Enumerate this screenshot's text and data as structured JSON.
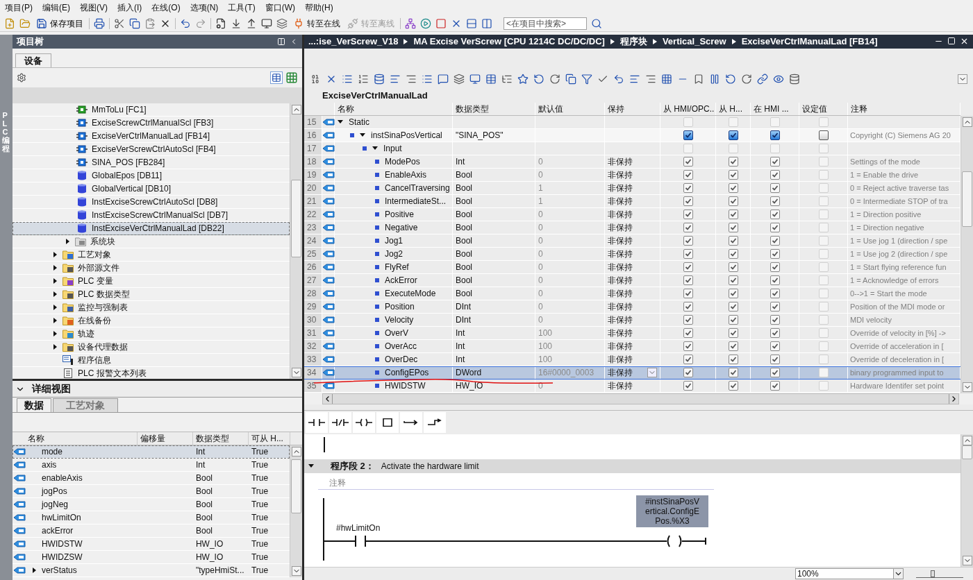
{
  "menu": [
    "项目(P)",
    "编辑(E)",
    "视图(V)",
    "插入(I)",
    "在线(O)",
    "选项(N)",
    "工具(T)",
    "窗口(W)",
    "帮助(H)"
  ],
  "toolbar": {
    "save_label": "保存项目",
    "go_online": {
      "label": "转至在线",
      "disabled": false
    },
    "go_offline": {
      "label": "转至离线",
      "disabled": true
    },
    "search_placeholder": "<在项目中搜索>"
  },
  "side_strip": "PLC 编程",
  "project_tree": {
    "title": "项目树",
    "tabs": [
      {
        "label": "设备",
        "selected": true
      }
    ],
    "blocks": [
      {
        "kind": "fc",
        "label": "MmToLu [FC1]",
        "selected": false
      },
      {
        "kind": "fb",
        "label": "ExciseScrewCtrlManualScl [FB3]",
        "selected": false
      },
      {
        "kind": "fb",
        "label": "ExciseVerCtrlManualLad [FB14]",
        "selected": false
      },
      {
        "kind": "fb",
        "label": "ExciseVerScrewCtrlAutoScl [FB4]",
        "selected": false
      },
      {
        "kind": "fb",
        "label": "SINA_POS [FB284]",
        "selected": false
      },
      {
        "kind": "db",
        "label": "GlobalEpos [DB11]",
        "selected": false
      },
      {
        "kind": "db",
        "label": "GlobalVertical [DB10]",
        "selected": false
      },
      {
        "kind": "db",
        "label": "InstExciseScrewCtrlAutoScl [DB8]",
        "selected": false
      },
      {
        "kind": "db",
        "label": "InstExciseScrewCtrlManualScl [DB7]",
        "selected": false
      },
      {
        "kind": "db",
        "label": "InstExciseVerCtrlManualLad [DB22]",
        "selected": true
      }
    ],
    "system_blocks": {
      "label": "系统块",
      "expanded": false
    },
    "folders": [
      {
        "kind": "tech",
        "label": "工艺对象",
        "expanded": false
      },
      {
        "kind": "source",
        "label": "外部源文件",
        "expanded": false
      },
      {
        "kind": "tags",
        "label": "PLC 变量",
        "expanded": false
      },
      {
        "kind": "types",
        "label": "PLC 数据类型",
        "expanded": false
      },
      {
        "kind": "watch",
        "label": "监控与强制表",
        "expanded": false
      },
      {
        "kind": "backup",
        "label": "在线备份",
        "expanded": false
      },
      {
        "kind": "trace",
        "label": "轨迹",
        "expanded": false
      },
      {
        "kind": "proxy",
        "label": "设备代理数据",
        "expanded": false
      }
    ],
    "entries": [
      {
        "kind": "info",
        "label": "程序信息"
      },
      {
        "kind": "textlist",
        "label": "PLC 报警文本列表"
      }
    ]
  },
  "detail_view": {
    "title": "详细视图",
    "tabs": [
      {
        "label": "数据",
        "selected": true
      },
      {
        "label": "工艺对象",
        "selected": false
      }
    ],
    "columns": [
      "名称",
      "偏移量",
      "数据类型",
      "可从 H..."
    ],
    "rows": [
      {
        "name": "mode",
        "type": "Int",
        "access": "True",
        "selected": true
      },
      {
        "name": "axis",
        "type": "Int",
        "access": "True",
        "selected": false
      },
      {
        "name": "enableAxis",
        "type": "Bool",
        "access": "True",
        "selected": false
      },
      {
        "name": "jogPos",
        "type": "Bool",
        "access": "True",
        "selected": false
      },
      {
        "name": "jogNeg",
        "type": "Bool",
        "access": "True",
        "selected": false
      },
      {
        "name": "hwLimitOn",
        "type": "Bool",
        "access": "True",
        "selected": false
      },
      {
        "name": "ackError",
        "type": "Bool",
        "access": "True",
        "selected": false
      },
      {
        "name": "HWIDSTW",
        "type": "HW_IO",
        "access": "True",
        "selected": false
      },
      {
        "name": "HWIDZSW",
        "type": "HW_IO",
        "access": "True",
        "selected": false
      },
      {
        "name": "verStatus",
        "type": "\"typeHmiSt...",
        "access": "True",
        "selected": false,
        "expanded": false
      }
    ]
  },
  "editor": {
    "breadcrumb": [
      "...:ise_VerScrew_V18",
      "MA Excise VerScrew [CPU 1214C DC/DC/DC]",
      "程序块",
      "Vertical_Screw",
      "ExciseVerCtrlManualLad [FB14]"
    ],
    "block_title": "ExciseVerCtrlManualLad",
    "columns": [
      "名称",
      "数据类型",
      "默认值",
      "保持",
      "从 HMI/OPC..",
      "从 H...",
      "在 HMI ...",
      "设定值",
      "注释"
    ],
    "rows": [
      {
        "num": "15",
        "name": "Static",
        "expanded": true,
        "selected": false,
        "editable": false,
        "hmi_1": false,
        "hmi_2": false,
        "hmi_3": false,
        "setpoint": false,
        "children": [
          {
            "num": "16",
            "name": "instSinaPosVertical",
            "type": "\"SINA_POS\"",
            "expanded": true,
            "selected": false,
            "editable": true,
            "hmi_1": true,
            "hmi_2": true,
            "hmi_3": true,
            "setpoint": false,
            "comment": "Copyright (C) Siemens AG 20",
            "children": [
              {
                "num": "17",
                "name": "Input",
                "expanded": true,
                "selected": false,
                "editable": false,
                "hmi_1": false,
                "hmi_2": false,
                "hmi_3": false,
                "setpoint": false,
                "children": [
                  {
                    "num": "18",
                    "name": "ModePos",
                    "type": "Int",
                    "default": "0",
                    "retain": "非保持",
                    "selected": false,
                    "editable": false,
                    "hmi_1": true,
                    "hmi_2": true,
                    "hmi_3": true,
                    "setpoint": false,
                    "comment": "Settings of the mode"
                  },
                  {
                    "num": "19",
                    "name": "EnableAxis",
                    "type": "Bool",
                    "default": "0",
                    "retain": "非保持",
                    "selected": false,
                    "editable": false,
                    "hmi_1": true,
                    "hmi_2": true,
                    "hmi_3": true,
                    "setpoint": false,
                    "comment": "1 = Enable the drive"
                  },
                  {
                    "num": "20",
                    "name": "CancelTraversing",
                    "type": "Bool",
                    "default": "1",
                    "retain": "非保持",
                    "selected": false,
                    "editable": false,
                    "hmi_1": true,
                    "hmi_2": true,
                    "hmi_3": true,
                    "setpoint": false,
                    "comment": "0 = Reject active traverse tas"
                  },
                  {
                    "num": "21",
                    "name": "IntermediateSt...",
                    "type": "Bool",
                    "default": "1",
                    "retain": "非保持",
                    "selected": false,
                    "editable": false,
                    "hmi_1": true,
                    "hmi_2": true,
                    "hmi_3": true,
                    "setpoint": false,
                    "comment": "0 = Intermediate STOP of tra"
                  },
                  {
                    "num": "22",
                    "name": "Positive",
                    "type": "Bool",
                    "default": "0",
                    "retain": "非保持",
                    "selected": false,
                    "editable": false,
                    "hmi_1": true,
                    "hmi_2": true,
                    "hmi_3": true,
                    "setpoint": false,
                    "comment": "1 = Direction positive"
                  },
                  {
                    "num": "23",
                    "name": "Negative",
                    "type": "Bool",
                    "default": "0",
                    "retain": "非保持",
                    "selected": false,
                    "editable": false,
                    "hmi_1": true,
                    "hmi_2": true,
                    "hmi_3": true,
                    "setpoint": false,
                    "comment": "1 = Direction negative"
                  },
                  {
                    "num": "24",
                    "name": "Jog1",
                    "type": "Bool",
                    "default": "0",
                    "retain": "非保持",
                    "selected": false,
                    "editable": false,
                    "hmi_1": true,
                    "hmi_2": true,
                    "hmi_3": true,
                    "setpoint": false,
                    "comment": "1 = Use jog 1 (direction / spe"
                  },
                  {
                    "num": "25",
                    "name": "Jog2",
                    "type": "Bool",
                    "default": "0",
                    "retain": "非保持",
                    "selected": false,
                    "editable": false,
                    "hmi_1": true,
                    "hmi_2": true,
                    "hmi_3": true,
                    "setpoint": false,
                    "comment": "1 = Use jog 2 (direction / spe"
                  },
                  {
                    "num": "26",
                    "name": "FlyRef",
                    "type": "Bool",
                    "default": "0",
                    "retain": "非保持",
                    "selected": false,
                    "editable": false,
                    "hmi_1": true,
                    "hmi_2": true,
                    "hmi_3": true,
                    "setpoint": false,
                    "comment": "1 = Start flying reference fun"
                  },
                  {
                    "num": "27",
                    "name": "AckError",
                    "type": "Bool",
                    "default": "0",
                    "retain": "非保持",
                    "selected": false,
                    "editable": false,
                    "hmi_1": true,
                    "hmi_2": true,
                    "hmi_3": true,
                    "setpoint": false,
                    "comment": "1  = Acknowledge of errors"
                  },
                  {
                    "num": "28",
                    "name": "ExecuteMode",
                    "type": "Bool",
                    "default": "0",
                    "retain": "非保持",
                    "selected": false,
                    "editable": false,
                    "hmi_1": true,
                    "hmi_2": true,
                    "hmi_3": true,
                    "setpoint": false,
                    "comment": "0-->1 = Start the mode"
                  },
                  {
                    "num": "29",
                    "name": "Position",
                    "type": "DInt",
                    "default": "0",
                    "retain": "非保持",
                    "selected": false,
                    "editable": false,
                    "hmi_1": true,
                    "hmi_2": true,
                    "hmi_3": true,
                    "setpoint": false,
                    "comment": "Position of the MDI mode or"
                  },
                  {
                    "num": "30",
                    "name": "Velocity",
                    "type": "DInt",
                    "default": "0",
                    "retain": "非保持",
                    "selected": false,
                    "editable": false,
                    "hmi_1": true,
                    "hmi_2": true,
                    "hmi_3": true,
                    "setpoint": false,
                    "comment": "MDI velocity"
                  },
                  {
                    "num": "31",
                    "name": "OverV",
                    "type": "Int",
                    "default": "100",
                    "retain": "非保持",
                    "selected": false,
                    "editable": false,
                    "hmi_1": true,
                    "hmi_2": true,
                    "hmi_3": true,
                    "setpoint": false,
                    "comment": "Override of  velocity in [%] ->"
                  },
                  {
                    "num": "32",
                    "name": "OverAcc",
                    "type": "Int",
                    "default": "100",
                    "retain": "非保持",
                    "selected": false,
                    "editable": false,
                    "hmi_1": true,
                    "hmi_2": true,
                    "hmi_3": true,
                    "setpoint": false,
                    "comment": "Override of acceleration in ["
                  },
                  {
                    "num": "33",
                    "name": "OverDec",
                    "type": "Int",
                    "default": "100",
                    "retain": "非保持",
                    "selected": false,
                    "editable": false,
                    "hmi_1": true,
                    "hmi_2": true,
                    "hmi_3": true,
                    "setpoint": false,
                    "comment": "Override of deceleration in ["
                  },
                  {
                    "num": "34",
                    "name": "ConfigEPos",
                    "type": "DWord",
                    "default": "16#0000_0003",
                    "retain": "非保持",
                    "selected": true,
                    "editable": false,
                    "hmi_1": true,
                    "hmi_2": true,
                    "hmi_3": true,
                    "setpoint": false,
                    "comment": "binary programmed input to"
                  },
                  {
                    "num": "35",
                    "name": "HWIDSTW",
                    "type": "HW_IO",
                    "default": "0",
                    "retain": "非保持",
                    "selected": false,
                    "editable": false,
                    "hmi_1": true,
                    "hmi_2": true,
                    "hmi_3": true,
                    "setpoint": false,
                    "comment": "Hardware Identifer set point"
                  }
                ]
              }
            ]
          }
        ]
      }
    ]
  },
  "network": {
    "title": "程序段 2：",
    "description": "Activate the hardware limit",
    "expanded": true,
    "comment_placeholder": "注释",
    "contact": "#hwLimitOn",
    "coil": "#instSinaPosVertical.ConfigEPos.%X3"
  },
  "status_bar": {
    "zoom": "100%",
    "zoom_slider": {
      "level": 0.35
    }
  }
}
